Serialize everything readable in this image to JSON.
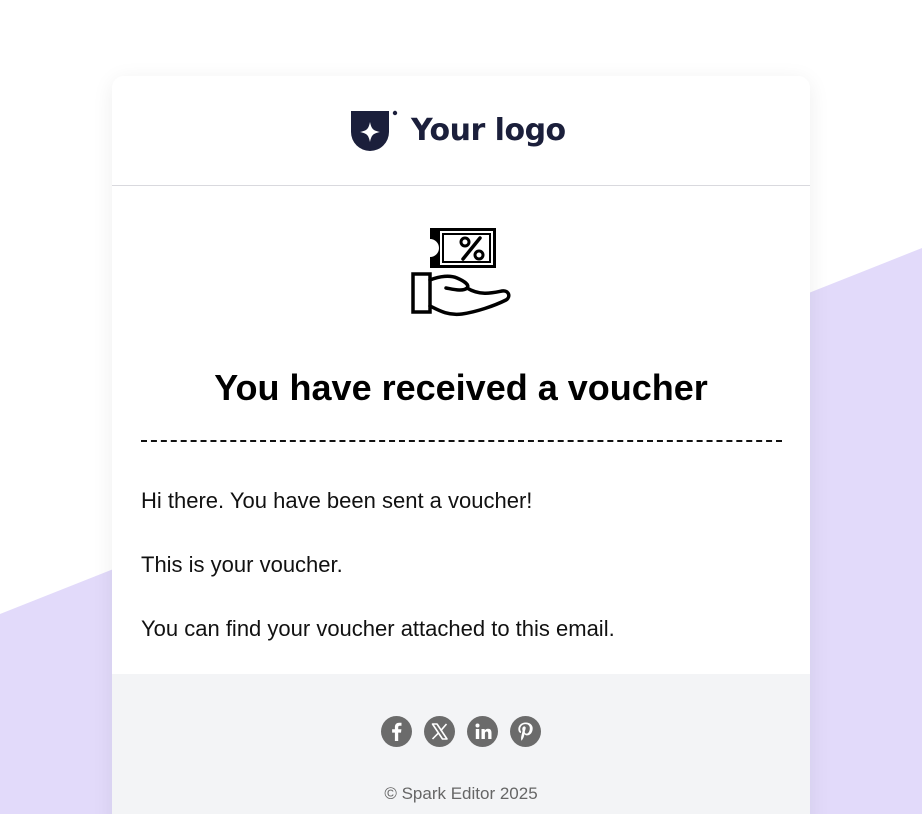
{
  "colors": {
    "accent_background": "#e2dafa",
    "logo_color": "#1b1f3b",
    "footer_background": "#f3f4f6",
    "social_icon_color": "#6b6b6b"
  },
  "header": {
    "logo_text": "Your logo"
  },
  "hero": {
    "icon": "voucher-hand-icon",
    "title": "You have received a voucher"
  },
  "body": {
    "paragraphs": [
      "Hi there. You have been sent a voucher!",
      "This is your voucher.",
      "You can find your voucher attached to this email."
    ]
  },
  "footer": {
    "social": [
      {
        "name": "facebook",
        "icon": "facebook-icon"
      },
      {
        "name": "x",
        "icon": "x-icon"
      },
      {
        "name": "linkedin",
        "icon": "linkedin-icon"
      },
      {
        "name": "pinterest",
        "icon": "pinterest-icon"
      }
    ],
    "copyright": "© Spark Editor 2025"
  }
}
